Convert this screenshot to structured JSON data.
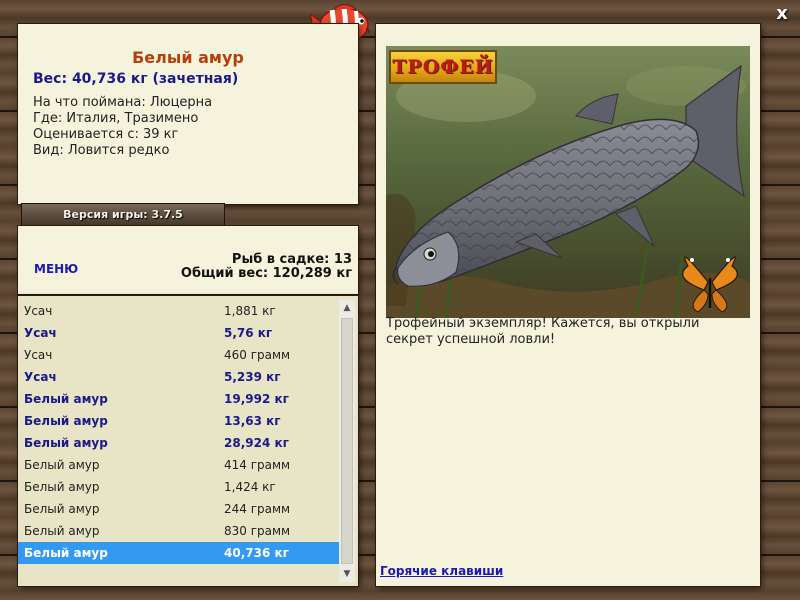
{
  "colors": {
    "panel_bg": "#f6f3dc",
    "list_bg": "#e8e5c6",
    "title_accent": "#b5400c",
    "notable_text": "#1a1a8c",
    "selected_row": "#3399f3",
    "link": "#1a1ab8"
  },
  "icons": {
    "logo": "red-striped-fish-icon",
    "close": "close-icon",
    "decoration": "butterfly-icon"
  },
  "fish_info": {
    "name": "Белый амур",
    "weight": "Вес: 40,736 кг (зачетная)",
    "bait": "На что поймана: Люцерна",
    "location": "Где: Италия, Тразимено",
    "rated_from": "Оценивается с: 39 кг",
    "kind": "Вид: Ловится редко"
  },
  "version": {
    "label": "Версия игры: 3.7.5"
  },
  "menu": {
    "label": "МЕНЮ"
  },
  "stats": {
    "fish_count": "Рыб в садке: 13",
    "total_weight": "Общий вес: 120,289 кг"
  },
  "catch_list": [
    {
      "name": "Усач",
      "weight": "1,881 кг",
      "notable": false,
      "selected": false
    },
    {
      "name": "Усач",
      "weight": "5,76 кг",
      "notable": true,
      "selected": false
    },
    {
      "name": "Усач",
      "weight": "460 грамм",
      "notable": false,
      "selected": false
    },
    {
      "name": "Усач",
      "weight": "5,239 кг",
      "notable": true,
      "selected": false
    },
    {
      "name": "Белый амур",
      "weight": "19,992 кг",
      "notable": true,
      "selected": false
    },
    {
      "name": "Белый амур",
      "weight": "13,63 кг",
      "notable": true,
      "selected": false
    },
    {
      "name": "Белый амур",
      "weight": "28,924 кг",
      "notable": true,
      "selected": false
    },
    {
      "name": "Белый амур",
      "weight": "414 грамм",
      "notable": false,
      "selected": false
    },
    {
      "name": "Белый амур",
      "weight": "1,424 кг",
      "notable": false,
      "selected": false
    },
    {
      "name": "Белый амур",
      "weight": "244 грамм",
      "notable": false,
      "selected": false
    },
    {
      "name": "Белый амур",
      "weight": "830 грамм",
      "notable": false,
      "selected": false
    },
    {
      "name": "Белый амур",
      "weight": "40,736 кг",
      "notable": false,
      "selected": true
    }
  ],
  "trophy": {
    "badge": "ТРОФЕЙ",
    "description": "Трофейный экземпляр! Кажется, вы открыли секрет успешной ловли!",
    "hotkeys_label": "Горячие клавиши"
  },
  "window": {
    "close_label": "x"
  }
}
